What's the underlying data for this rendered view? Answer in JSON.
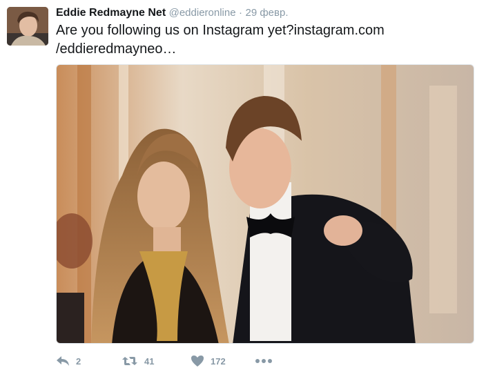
{
  "tweet": {
    "author_name": "Eddie Redmayne Net",
    "handle": "@eddieronline",
    "separator": "·",
    "date": "29 февр.",
    "text_line1": "Are you following us on Instagram yet?instagram.com",
    "text_line2": "/eddieredmayneo…"
  },
  "actions": {
    "reply_count": "2",
    "retweet_count": "41",
    "like_count": "172",
    "icons": [
      "reply-icon",
      "retweet-icon",
      "heart-icon",
      "more-icon"
    ]
  },
  "colors": {
    "text": "#14171a",
    "muted": "#8899a6"
  }
}
